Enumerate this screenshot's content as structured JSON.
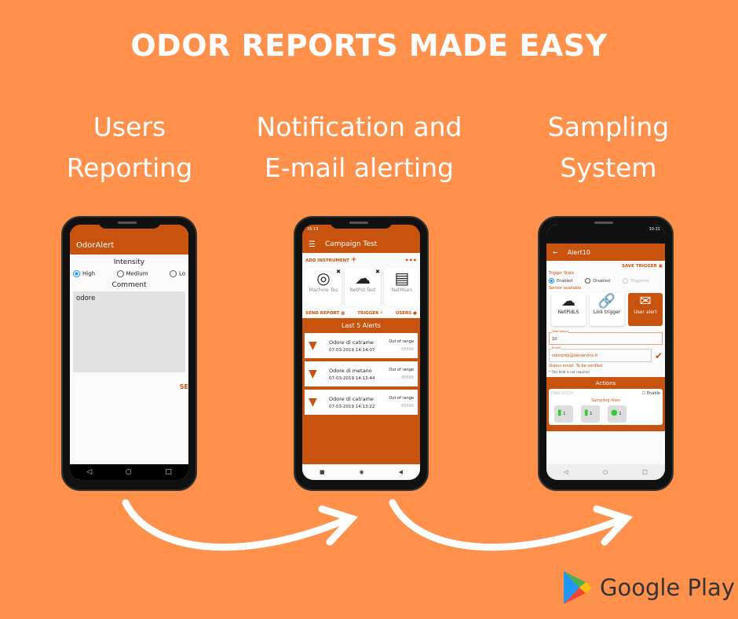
{
  "headline": "ODOR REPORTS MADE EASY",
  "columns": [
    {
      "line1": "Users",
      "line2": "Reporting"
    },
    {
      "line1": "Notification and",
      "line2": "E-mail alerting"
    },
    {
      "line1": "Sampling",
      "line2": "System"
    }
  ],
  "phone1": {
    "app_title": "OdorAlert",
    "intensity_label": "Intensity",
    "options": [
      "High",
      "Medium",
      "Lo"
    ],
    "selected": "High",
    "comment_label": "Comment",
    "comment_value": "odore",
    "send_label": "SE"
  },
  "phone2": {
    "time": "16:13",
    "title": "Campaign Test",
    "add_instrument": "ADD INSTRUMENT",
    "more": "•••",
    "instruments": [
      "Machine Tes",
      "NetPid Test",
      "NetMsen"
    ],
    "send_report": "SEND REPORT",
    "trigger": "TRIGGER",
    "users": "USERS",
    "alerts_title": "Last 5 Alerts",
    "alerts": [
      {
        "name": "Odore di catrame",
        "time": "07-03-2019 14:14:07",
        "status": "Out of range",
        "value": "88888"
      },
      {
        "name": "Odore di metano",
        "time": "07-03-2019 14:13:44",
        "status": "Out of range",
        "value": "88888"
      },
      {
        "name": "Odore di catrame",
        "time": "07-03-2019 14:13:22",
        "status": "Out of range",
        "value": "88888"
      }
    ]
  },
  "phone3": {
    "time": "10:31",
    "title": "Alert10",
    "save_trigger": "SAVE TRIGGER",
    "trigger_state": "Trigger State",
    "states": [
      "Enabled",
      "Disabled",
      "Triggered"
    ],
    "selected_state": "Enabled",
    "sensor_available": "Sensor available",
    "sensors": [
      "NetPidLS",
      "Link trigger",
      "User alert"
    ],
    "total_weight_label": "Total weight",
    "total_weight_value": "10",
    "email_label": "Email*",
    "email_value": "odorprep@labservice.it",
    "status_email": "Status email:  To be verified",
    "field_note": "* This field is not required",
    "actions_title": "Actions",
    "device": "Odor101V3",
    "enable_label": "Enable",
    "sampling_lines": "Sampling lines",
    "line_counts": [
      "1",
      "1",
      "1"
    ]
  },
  "store": {
    "label": "Google Play"
  },
  "colors": {
    "background": "#FF914D",
    "accent": "#C8530E"
  }
}
